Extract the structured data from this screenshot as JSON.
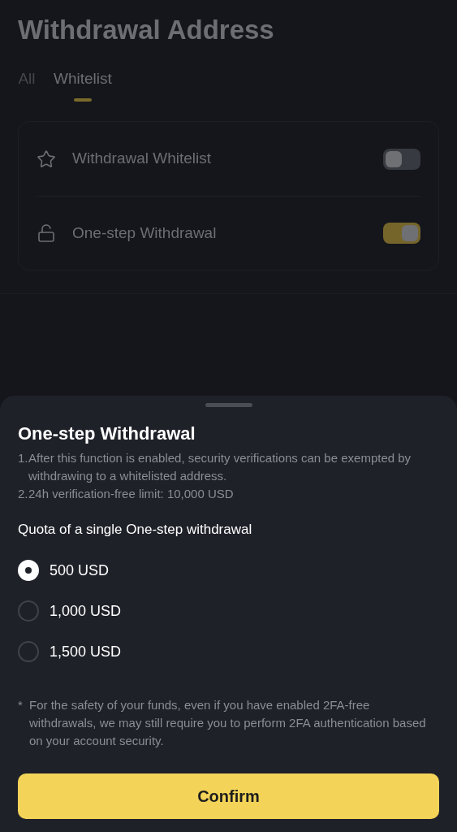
{
  "page": {
    "title": "Withdrawal Address",
    "tabs": [
      {
        "label": "All",
        "selected": false
      },
      {
        "label": "Whitelist",
        "selected": true
      }
    ],
    "settings": [
      {
        "kind": "star",
        "label": "Withdrawal Whitelist",
        "on": false
      },
      {
        "kind": "lock",
        "label": "One-step Withdrawal",
        "on": true
      }
    ]
  },
  "sheet": {
    "title": "One-step Withdrawal",
    "info": [
      {
        "number": "1.",
        "text": "After this function is enabled, security verifications can be exempted by withdrawing to a whitelisted address."
      },
      {
        "number": "2.",
        "text": "24h verification-free limit: 10,000 USD"
      }
    ],
    "quota_label": "Quota of a single One-step withdrawal",
    "options": [
      {
        "label": "500 USD",
        "selected": true
      },
      {
        "label": "1,000 USD",
        "selected": false
      },
      {
        "label": "1,500 USD",
        "selected": false
      }
    ],
    "note_marker": "*",
    "note": "For the safety of your funds, even if you have enabled 2FA-free withdrawals, we may still require you to perform 2FA authentication based on your account security.",
    "confirm": "Confirm"
  }
}
